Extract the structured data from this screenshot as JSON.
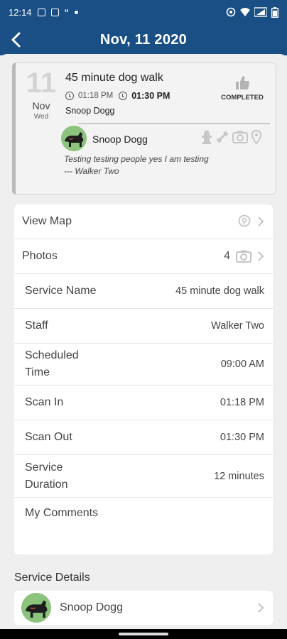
{
  "status_bar": {
    "time": "12:14",
    "left_icons": [
      "image-icon",
      "message-icon",
      "quote-icon",
      "dot-icon"
    ],
    "right_icons": [
      "hotspot-icon",
      "wifi-icon",
      "signal-icon",
      "battery-icon"
    ]
  },
  "header": {
    "title": "Nov, 11 2020",
    "back_icon": "back-arrow-icon",
    "color": "#1a4f86"
  },
  "visit": {
    "day": "11",
    "month": "Nov",
    "weekday": "Wed",
    "service": "45 minute dog walk",
    "time_in": "01:18 PM",
    "time_out": "01:30 PM",
    "pet": "Snoop Dogg",
    "status": "COMPLETED",
    "status_icon": "thumbs-up-icon",
    "pet_name": "Snoop Dogg",
    "note_line1": "Testing testing people yes I am testing",
    "note_line2": "--- Walker Two",
    "icons": [
      "hydrant-icon",
      "bone-icon",
      "camera-icon",
      "map-pin-icon"
    ]
  },
  "details": {
    "view_map": "View Map",
    "photos": "Photos",
    "photos_count": "4",
    "service_name_label": "Service Name",
    "service_name_value": "45 minute dog walk",
    "staff_label": "Staff",
    "staff_value": "Walker Two",
    "scheduled_label_1": "Scheduled",
    "scheduled_label_2": "Time",
    "scheduled_value": "09:00 AM",
    "scan_in_label": "Scan In",
    "scan_in_value": "01:18 PM",
    "scan_out_label": "Scan Out",
    "scan_out_value": "01:30 PM",
    "duration_label_1": "Service",
    "duration_label_2": "Duration",
    "duration_value": "12 minutes",
    "comments_label": "My Comments"
  },
  "service_details": {
    "title": "Service Details",
    "pet_name": "Snoop Dogg"
  }
}
